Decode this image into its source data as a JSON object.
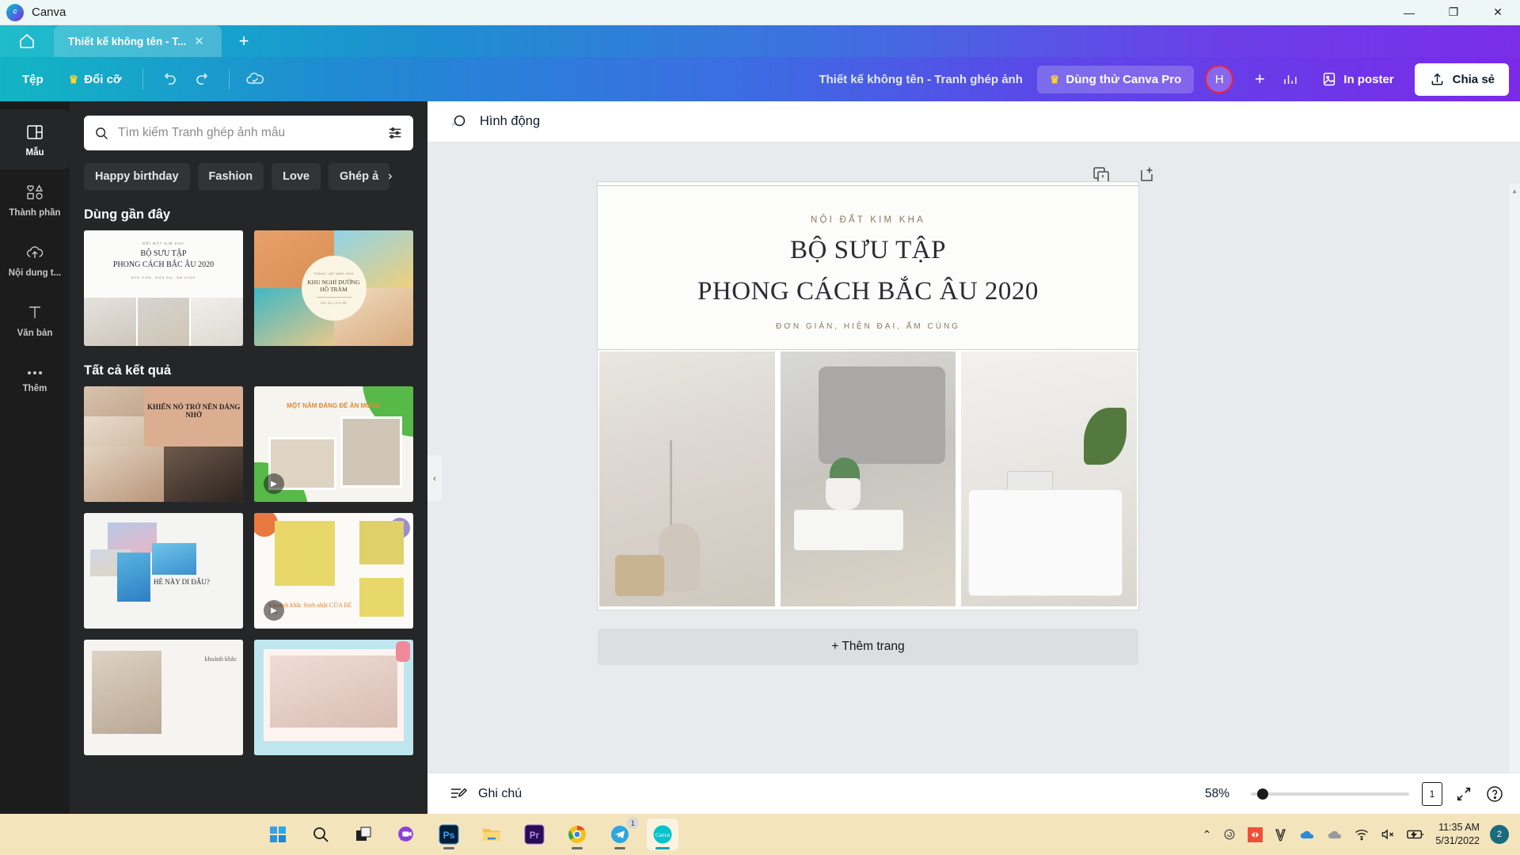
{
  "window": {
    "app_title": "Canva",
    "logo_text": "Canva",
    "controls": {
      "minimize": "—",
      "maximize": "❐",
      "close": "✕"
    }
  },
  "tabstrip": {
    "home_icon": "home-icon",
    "tab_label": "Thiết kế không tên - T...",
    "tab_close": "✕",
    "new_tab": "+"
  },
  "toolbar": {
    "file": "Tệp",
    "resize": "Đổi cỡ",
    "crown": "♛",
    "undo_icon": "undo-icon",
    "redo_icon": "redo-icon",
    "cloud_icon": "cloud-saved-icon",
    "doc_name": "Thiết kế không tên - Tranh ghép ảnh",
    "pro_label": "Dùng thử Canva Pro",
    "avatar_initial": "H",
    "add_member": "+",
    "insights_icon": "insights-icon",
    "print_label": "In poster",
    "print_icon": "print-poster-icon",
    "share_label": "Chia sẻ",
    "share_icon": "share-upload-icon"
  },
  "rail": {
    "items": [
      {
        "label": "Mẫu",
        "icon": "templates-icon",
        "active": true
      },
      {
        "label": "Thành phần",
        "icon": "elements-icon",
        "active": false
      },
      {
        "label": "Nội dung t...",
        "icon": "uploads-icon",
        "active": false
      },
      {
        "label": "Văn bản",
        "icon": "text-icon",
        "active": false
      },
      {
        "label": "Thêm",
        "icon": "more-icon",
        "active": false
      }
    ]
  },
  "panel": {
    "search": {
      "placeholder": "Tìm kiếm Tranh ghép ảnh mẫu",
      "value": "",
      "search_icon": "search-icon",
      "filter_icon": "filter-sliders-icon"
    },
    "chips": [
      "Happy birthday",
      "Fashion",
      "Love",
      "Ghép ả"
    ],
    "chips_next": "›",
    "recent_title": "Dùng gần đây",
    "results_title": "Tất cả kết quả",
    "recent": [
      {
        "name": "nordic-collection-template",
        "eyebrow": "NỘI ĐẤT KIM KHA",
        "line1": "BỘ SƯU TẬP",
        "line2": "PHONG CÁCH BẮC ÂU 2020",
        "sub": "ĐƠN GIẢN, HIỆN ĐẠI, ẤM CÚNG"
      },
      {
        "name": "resort-template",
        "eyebrow": "THÀNH LẬP NĂM 1969",
        "line1": "KHU NGHỈ DƯỠNG",
        "line2": "HỒ TRÀM",
        "sub": "GÓI DU LỊCH RẺ"
      }
    ],
    "results": [
      {
        "name": "memorable-template",
        "title": "KHIẾN NÓ TRỞ NÊN DÁNG NHỚ",
        "video": false
      },
      {
        "name": "one-year-template",
        "title": "MỘT NĂM ĐÁNG ĐỂ ĂN MỪNG",
        "video": true
      },
      {
        "name": "summer-template",
        "title": "HÈ NÀY DI ĐÂU?",
        "video": false
      },
      {
        "name": "birthday-template",
        "title": "Khoảnh khắc Sinh nhật CỦA BÉ AN",
        "video": true
      },
      {
        "name": "family-template",
        "title": "khoảnh khắc",
        "video": false
      },
      {
        "name": "baby-template",
        "title": "",
        "video": false
      }
    ],
    "collapse_arrow": "‹"
  },
  "editor": {
    "animate_label": "Hình động",
    "animate_icon": "animate-icon",
    "duplicate_page_icon": "duplicate-page-icon",
    "add_page_icon": "add-page-icon",
    "comment_icon": "add-comment-icon",
    "add_page_label": "+ Thêm trang",
    "design": {
      "eyebrow": "NỘI ĐẤT KIM KHA",
      "title_line1": "BỘ SƯU TẬP",
      "title_line2": "PHONG CÁCH BẮC ÂU 2020",
      "subtitle": "ĐƠN GIẢN, HIỆN ĐẠI, ẤM CÚNG",
      "photos": [
        "vase-with-gypsophila-photo",
        "living-room-coffee-table-photo",
        "white-sofa-laptop-photo"
      ]
    },
    "scroll_left": "◂",
    "scroll_right": "▸",
    "scroll_up": "▴",
    "scroll_down": "▾",
    "collapse_caret": "⌃"
  },
  "statusbar": {
    "notes_label": "Ghi chú",
    "notes_icon": "notes-icon",
    "zoom_value": "58%",
    "page_number": "1",
    "fullscreen_icon": "fullscreen-icon",
    "help_icon": "help-icon"
  },
  "taskbar": {
    "apps": [
      {
        "name": "start-button",
        "glyph": "start",
        "badge": "",
        "running": false,
        "active": false
      },
      {
        "name": "search-taskbar-icon",
        "glyph": "search",
        "badge": "",
        "running": false,
        "active": false
      },
      {
        "name": "task-view-icon",
        "glyph": "taskview",
        "badge": "",
        "running": false,
        "active": false
      },
      {
        "name": "teams-chat-icon",
        "glyph": "teams",
        "badge": "",
        "running": false,
        "active": false
      },
      {
        "name": "photoshop-icon",
        "glyph": "Ps",
        "badge": "",
        "running": true,
        "active": false
      },
      {
        "name": "file-explorer-icon",
        "glyph": "folder",
        "badge": "",
        "running": false,
        "active": false
      },
      {
        "name": "premiere-pro-icon",
        "glyph": "Pr",
        "badge": "",
        "running": false,
        "active": false
      },
      {
        "name": "chrome-icon",
        "glyph": "chrome",
        "badge": "",
        "running": true,
        "active": false
      },
      {
        "name": "telegram-icon",
        "glyph": "telegram",
        "badge": "1",
        "running": true,
        "active": false
      },
      {
        "name": "canva-app-icon",
        "glyph": "canva",
        "badge": "",
        "running": true,
        "active": true
      }
    ],
    "tray": {
      "chevron": "⌃",
      "icons": [
        "creative-cloud-icon",
        "adobe-red-icon",
        "vpn-v-icon",
        "onedrive-blue-icon",
        "onedrive-grey-icon",
        "wifi-icon",
        "volume-muted-icon",
        "battery-charging-icon"
      ],
      "time": "11:35 AM",
      "date": "5/31/2022",
      "notification_count": "2"
    }
  },
  "colors": {
    "brand_teal": "#00c4cc",
    "brand_purple": "#7d2ae8",
    "taskbar_bg": "#f3e4bc",
    "panel_bg": "#252627",
    "rail_bg": "#1c1c1c",
    "editor_bg": "#e8eaed",
    "avatar_ring": "#f0203a"
  }
}
